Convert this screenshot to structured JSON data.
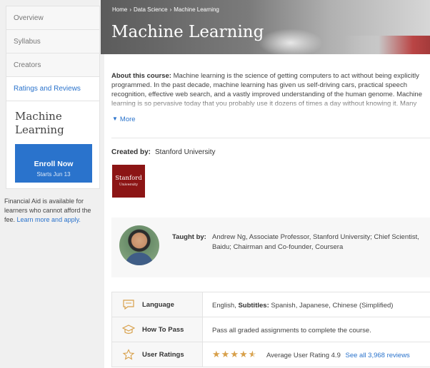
{
  "sidebar": {
    "items": [
      {
        "label": "Overview"
      },
      {
        "label": "Syllabus"
      },
      {
        "label": "Creators"
      },
      {
        "label": "Ratings and Reviews"
      }
    ],
    "card": {
      "title": "Machine Learning",
      "enroll_label": "Enroll Now",
      "enroll_sub": "Starts Jun 13"
    },
    "financial_aid_text": "Financial Aid is available for learners who cannot afford the fee.",
    "financial_aid_link": "Learn more and apply."
  },
  "hero": {
    "breadcrumb": [
      "Home",
      "Data Science",
      "Machine Learning"
    ],
    "title": "Machine Learning"
  },
  "about": {
    "label": "About this course:",
    "text": "Machine learning is the science of getting computers to act without being explicitly programmed. In the past decade, machine learning has given us self-driving cars, practical speech recognition, effective web search, and a vastly improved understanding of the human genome. Machine learning is so pervasive today that you probably use it dozens of times a day without knowing it. Many",
    "more_label": "More"
  },
  "created": {
    "label": "Created by:",
    "value": "Stanford University",
    "logo_line1": "Stanford",
    "logo_line2": "University"
  },
  "instructor": {
    "label": "Taught by:",
    "value": "Andrew Ng, Associate Professor, Stanford University; Chief Scientist, Baidu; Chairman and Co-founder, Coursera"
  },
  "info": {
    "language": {
      "label": "Language",
      "value": "English,",
      "subtitles_label": "Subtitles:",
      "subtitles_value": "Spanish, Japanese, Chinese (Simplified)"
    },
    "how_to_pass": {
      "label": "How To Pass",
      "value": "Pass all graded assignments to complete the course."
    },
    "ratings": {
      "label": "User Ratings",
      "stars": 4.5,
      "average": "Average User Rating 4.9",
      "reviews_link": "See all 3,968 reviews"
    }
  },
  "colors": {
    "accent": "#2a73cc",
    "stanford": "#8c1515",
    "star": "#d8a04a"
  }
}
